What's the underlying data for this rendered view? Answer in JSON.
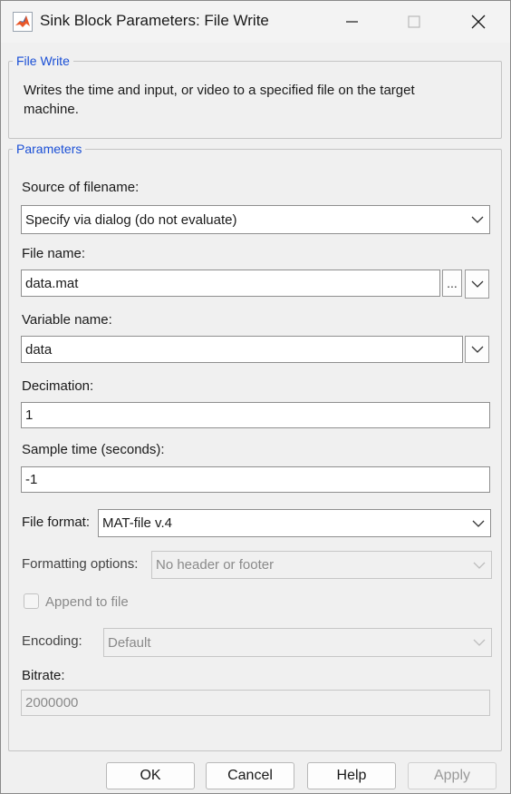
{
  "window": {
    "title": "Sink Block Parameters: File Write"
  },
  "description_group": {
    "legend": "File Write",
    "text": "Writes the time and input, or video to a specified file on the target machine."
  },
  "parameters_group": {
    "legend": "Parameters",
    "source_of_filename": {
      "label": "Source of filename:",
      "value": "Specify via dialog (do not evaluate)"
    },
    "file_name": {
      "label": "File name:",
      "value": "data.mat",
      "browse_label": "..."
    },
    "variable_name": {
      "label": "Variable name:",
      "value": "data"
    },
    "decimation": {
      "label": "Decimation:",
      "value": "1"
    },
    "sample_time": {
      "label": "Sample time (seconds):",
      "value": "-1"
    },
    "file_format": {
      "label": "File format:",
      "value": "MAT-file v.4"
    },
    "formatting_options": {
      "label": "Formatting options:",
      "value": "No header or footer"
    },
    "append_to_file": {
      "label": "Append to file",
      "checked": false
    },
    "encoding": {
      "label": "Encoding:",
      "value": "Default"
    },
    "bitrate": {
      "label": "Bitrate:",
      "value": "2000000"
    }
  },
  "footer": {
    "ok": "OK",
    "cancel": "Cancel",
    "help": "Help",
    "apply": "Apply"
  },
  "colors": {
    "legend": "#1a4fd6",
    "window_bg": "#f0f0f0",
    "matlab_icon": "#e8582a"
  }
}
